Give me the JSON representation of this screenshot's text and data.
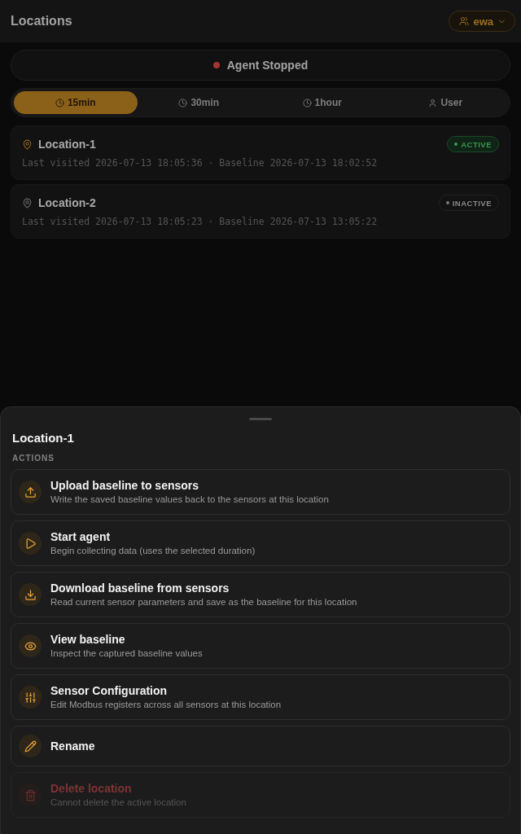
{
  "header": {
    "title": "Locations",
    "user": {
      "label": "ewa"
    }
  },
  "agent_status": {
    "label": "Agent Stopped",
    "running": false
  },
  "tabs": [
    {
      "label": "15min",
      "selected": true
    },
    {
      "label": "30min",
      "selected": false
    },
    {
      "label": "1hour",
      "selected": false
    },
    {
      "label": "User",
      "selected": false
    }
  ],
  "locations": [
    {
      "name": "Location-1",
      "details": "Last visited 2026-07-13 18:05:36 · Baseline 2026-07-13 18:02:52",
      "status": "ACTIVE",
      "active": true
    },
    {
      "name": "Location-2",
      "details": "Last visited 2026-07-13 18:05:23 · Baseline 2026-07-13 13:05:22",
      "status": "INACTIVE",
      "active": false
    }
  ],
  "sheet": {
    "title": "Location-1",
    "section_label": "ACTIONS",
    "actions": [
      {
        "kind": "default",
        "title": "Upload baseline to sensors",
        "description": "Write the saved baseline values back to the sensors at this location",
        "disabled": false
      },
      {
        "kind": "default",
        "title": "Start agent",
        "description": "Begin collecting data (uses the selected duration)",
        "disabled": false
      },
      {
        "kind": "default",
        "title": "Download baseline from sensors",
        "description": "Read current sensor parameters and save as the baseline for this location",
        "disabled": false
      },
      {
        "kind": "default",
        "title": "View baseline",
        "description": "Inspect the captured baseline values",
        "disabled": false
      },
      {
        "kind": "default",
        "title": "Sensor Configuration",
        "description": "Edit Modbus registers across all sensors at this location",
        "disabled": false
      },
      {
        "kind": "default",
        "title": "Rename",
        "disabled": false
      },
      {
        "kind": "danger",
        "title": "Delete location",
        "description": "Cannot delete the active location",
        "disabled": true
      }
    ]
  }
}
